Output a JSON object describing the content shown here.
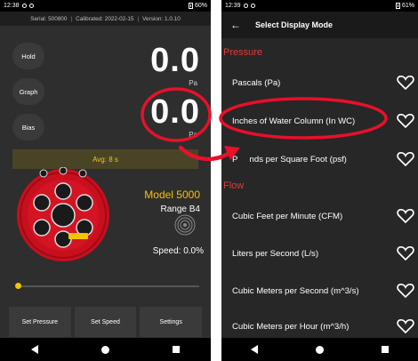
{
  "left_phone": {
    "status": {
      "time": "12:38",
      "battery": "60%"
    },
    "info": {
      "serial": "Serial: 500800",
      "calibrated": "Calibrated: 2022-02-15",
      "version": "Version: 1.0.10"
    },
    "side_buttons": [
      "Hold",
      "Graph",
      "Bias"
    ],
    "readings": [
      {
        "value": "0.0",
        "unit": "Pa"
      },
      {
        "value": "0.0",
        "unit": "Pa"
      }
    ],
    "avg": "Avg: 8 s",
    "model": "Model 5000",
    "range": "Range B4",
    "speed": "Speed: 0.0%",
    "slider_fraction": 0.0,
    "bottom_buttons": [
      "Set Pressure",
      "Set Speed",
      "Settings"
    ]
  },
  "right_phone": {
    "status": {
      "time": "12:39",
      "battery": "61%"
    },
    "header": {
      "back": "←",
      "title": "Select Display Mode"
    },
    "sections": [
      {
        "title": "Pressure",
        "options": [
          "Pascals (Pa)",
          "Inches of Water Column (In WC)",
          "Pounds per Square Foot (psf)"
        ]
      },
      {
        "title": "Flow",
        "options": [
          "Cubic Feet per Minute (CFM)",
          "Liters per Second (L/s)",
          "Cubic Meters per Second (m^3/s)",
          "Cubic Meters per Hour (m^3/h)"
        ]
      }
    ],
    "partial_option_text": "P     nds per Square Foot (psf)"
  },
  "colors": {
    "accent_yellow": "#f4c400",
    "annotation_red": "#e8102a",
    "section_red": "#e53935"
  },
  "icons": [
    "back-arrow-icon",
    "heart-icon",
    "fan-icon",
    "battery-icon",
    "nav-back-icon",
    "nav-home-icon",
    "nav-recent-icon"
  ]
}
